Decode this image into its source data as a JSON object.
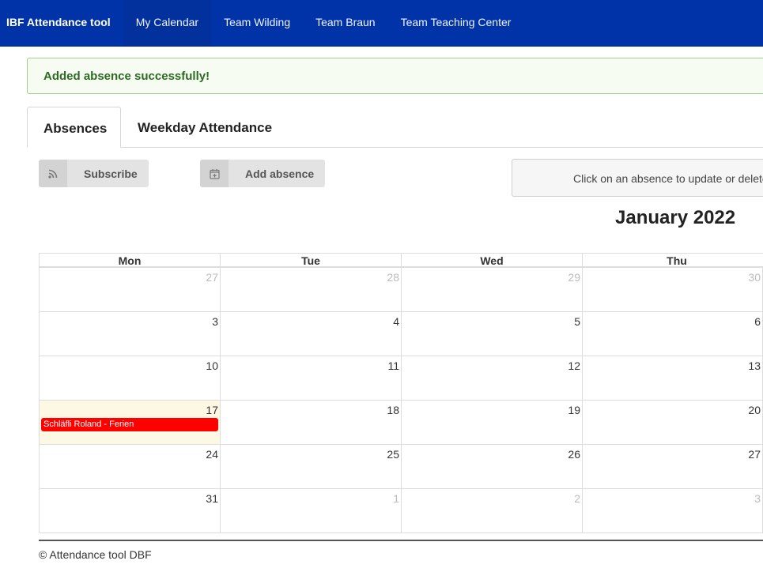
{
  "navbar": {
    "brand": "IBF Attendance tool",
    "items": [
      {
        "label": "My Calendar"
      },
      {
        "label": "Team Wilding"
      },
      {
        "label": "Team Braun"
      },
      {
        "label": "Team Teaching Center"
      }
    ]
  },
  "alert": {
    "text": "Added absence successfully!"
  },
  "tabs": [
    {
      "label": "Absences"
    },
    {
      "label": "Weekday Attendance"
    }
  ],
  "toolbar": {
    "subscribe_label": "Subscribe",
    "subscribe_icon": "rss-icon",
    "add_absence_label": "Add absence",
    "add_absence_icon": "calendar-plus-icon",
    "hint": "Click on an absence to update or delete"
  },
  "calendar": {
    "title": "January 2022",
    "weekdays": [
      "Mon",
      "Tue",
      "Wed",
      "Thu"
    ],
    "weeks": [
      [
        "27",
        "28",
        "29",
        "30"
      ],
      [
        "3",
        "4",
        "5",
        "6"
      ],
      [
        "10",
        "11",
        "12",
        "13"
      ],
      [
        "17",
        "18",
        "19",
        "20"
      ],
      [
        "24",
        "25",
        "26",
        "27"
      ],
      [
        "31",
        "1",
        "2",
        "3"
      ]
    ],
    "event": {
      "label": "Schläfli Roland - Ferien",
      "color": "#ff0000"
    }
  },
  "footer": {
    "text": "© Attendance tool DBF"
  }
}
